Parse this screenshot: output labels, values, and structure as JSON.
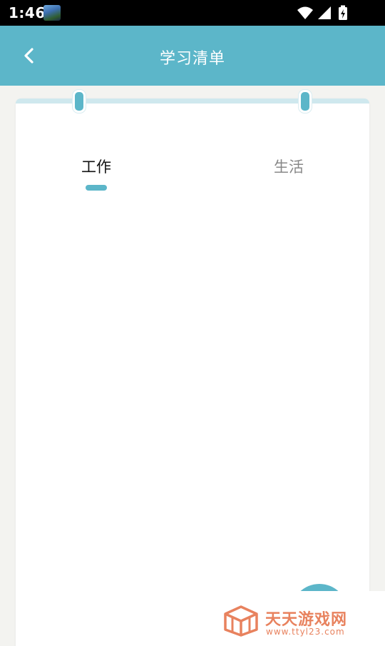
{
  "status_bar": {
    "time": "1:46",
    "icons": [
      "gallery-app-icon",
      "wifi-icon",
      "signal-icon",
      "battery-charging-icon"
    ]
  },
  "header": {
    "title": "学习清单",
    "back_icon": "chevron-left-icon",
    "background_color": "#5cb6c9"
  },
  "tabs": [
    {
      "label": "工作",
      "selected": true
    },
    {
      "label": "生活",
      "selected": false
    }
  ],
  "fab": {
    "icon": "add-icon"
  },
  "watermark": {
    "title": "天天游戏网",
    "url": "www.ttyl23.com",
    "color": "#e8825e"
  }
}
